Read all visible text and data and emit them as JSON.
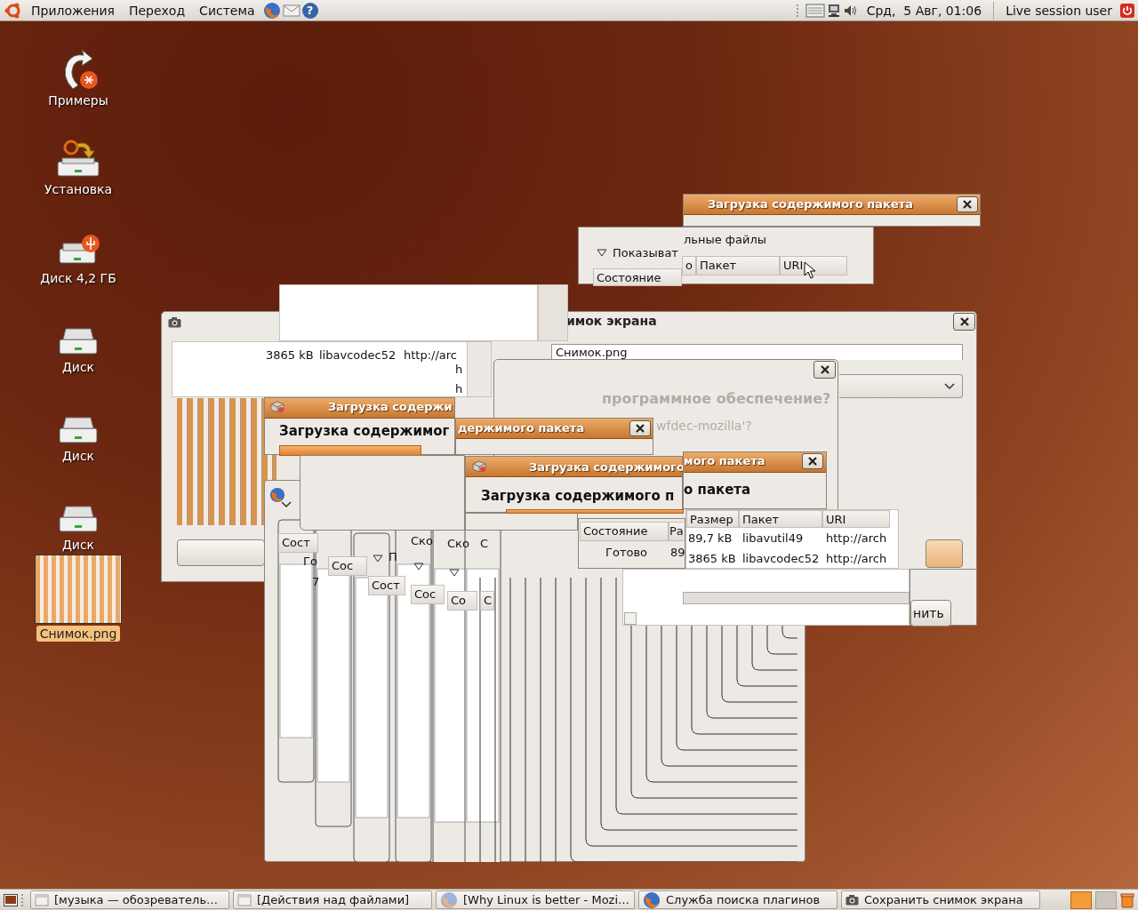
{
  "top_panel": {
    "menus": [
      "Приложения",
      "Переход",
      "Система"
    ],
    "help_glyph": "?",
    "clock": "Срд,  5 Авг, 01:06",
    "user": "Live session user"
  },
  "desktop_icons": [
    {
      "label": "Примеры",
      "kind": "examples",
      "selected": false
    },
    {
      "label": "Установка",
      "kind": "install",
      "selected": false
    },
    {
      "label": "Диск 4,2 ГБ",
      "kind": "usb",
      "selected": false
    },
    {
      "label": "Диск",
      "kind": "disk",
      "selected": false
    },
    {
      "label": "Диск",
      "kind": "disk",
      "selected": false
    },
    {
      "label": "Диск",
      "kind": "disk",
      "selected": false
    },
    {
      "label": "Снимок.png",
      "kind": "image",
      "selected": true
    }
  ],
  "windows": [
    {
      "kind": "panel",
      "items": [
        {
          "kind": "text",
          "text": "льные файлы"
        },
        {
          "kind": "expander"
        },
        {
          "kind": "text",
          "text": "Показыват"
        },
        {
          "kind": "header",
          "text": "Состояние"
        },
        {
          "kind": "header",
          "text": "о"
        },
        {
          "kind": "header",
          "text": "Пакет"
        },
        {
          "kind": "header",
          "text": "URI"
        },
        {
          "kind": "cursor"
        }
      ]
    },
    {
      "kind": "titled",
      "items": [
        {
          "kind": "title",
          "text": "Загрузка содержимого пакета"
        },
        {
          "kind": "close"
        }
      ]
    },
    {
      "kind": "dialog",
      "items": [
        {
          "kind": "camera"
        },
        {
          "kind": "title_dark",
          "text": "имок экрана"
        },
        {
          "kind": "close"
        },
        {
          "kind": "field",
          "text": "Снимок.png"
        },
        {
          "kind": "combo"
        },
        {
          "kind": "photo"
        },
        {
          "kind": "button"
        },
        {
          "kind": "default_button"
        }
      ]
    },
    {
      "kind": "white",
      "items": [
        {
          "kind": "cell",
          "text": "3865 kB"
        },
        {
          "kind": "cell",
          "text": "libavcodec52"
        },
        {
          "kind": "cell",
          "text": "http://arc"
        },
        {
          "kind": "cell",
          "text": "h"
        },
        {
          "kind": "cell",
          "text": "h"
        }
      ]
    },
    {
      "kind": "dialog",
      "items": [
        {
          "kind": "close"
        },
        {
          "kind": "muted_heading",
          "text": "программное обеспечение?"
        },
        {
          "kind": "muted",
          "text": "wfdec-mozilla'?"
        }
      ]
    },
    {
      "kind": "titled",
      "items": [
        {
          "kind": "package"
        },
        {
          "kind": "title",
          "text": "Загрузка содержи"
        },
        {
          "kind": "heading",
          "text": "Загрузка содержимог"
        },
        {
          "kind": "bar",
          "level": 1
        }
      ]
    },
    {
      "kind": "titled",
      "items": [
        {
          "kind": "title",
          "text": "держимого пакета"
        },
        {
          "kind": "close"
        }
      ]
    },
    {
      "kind": "cascade",
      "items": [
        {
          "kind": "firefox"
        },
        {
          "kind": "chevron"
        },
        {
          "kind": "header",
          "text": "Сост"
        },
        {
          "kind": "cell",
          "text": "Го"
        },
        {
          "kind": "cell",
          "text": "7"
        },
        {
          "kind": "header",
          "text": "Сос"
        },
        {
          "kind": "expander"
        },
        {
          "kind": "text",
          "text": "П"
        },
        {
          "kind": "header",
          "text": "Сост"
        },
        {
          "kind": "text",
          "text": "Ско"
        },
        {
          "kind": "expander"
        },
        {
          "kind": "header",
          "text": "Сос"
        },
        {
          "kind": "text",
          "text": "Ско"
        },
        {
          "kind": "expander"
        },
        {
          "kind": "header",
          "text": "Со"
        },
        {
          "kind": "text",
          "text": "С"
        },
        {
          "kind": "header",
          "text": "С"
        }
      ]
    },
    {
      "kind": "titled",
      "items": [
        {
          "kind": "package"
        },
        {
          "kind": "title",
          "text": "Загрузка содержимого"
        },
        {
          "kind": "heading",
          "text": "Загрузка содержимого п"
        },
        {
          "kind": "bar",
          "level": 1
        }
      ]
    },
    {
      "kind": "titled",
      "items": [
        {
          "kind": "title",
          "text": "мого пакета"
        },
        {
          "kind": "close"
        },
        {
          "kind": "heading",
          "text": "о пакета"
        }
      ]
    },
    {
      "kind": "panel",
      "items": [
        {
          "kind": "header",
          "text": "Состояние"
        },
        {
          "kind": "header",
          "text": "Ра"
        },
        {
          "kind": "cell",
          "text": "Готово"
        },
        {
          "kind": "cell",
          "text": "89"
        }
      ]
    },
    {
      "kind": "white",
      "items": [
        {
          "kind": "header",
          "text": "Размер"
        },
        {
          "kind": "header",
          "text": "Пакет"
        },
        {
          "kind": "header",
          "text": "URI"
        },
        {
          "kind": "cell",
          "text": "89,7 kB"
        },
        {
          "kind": "cell",
          "text": "libavutil49"
        },
        {
          "kind": "cell",
          "text": "http://arch"
        },
        {
          "kind": "cell",
          "text": "3865 kB"
        },
        {
          "kind": "cell",
          "text": "libavcodec52"
        },
        {
          "kind": "cell",
          "text": "http://arch"
        }
      ]
    },
    {
      "kind": "panel",
      "items": [
        {
          "kind": "button",
          "text": "нить"
        }
      ]
    }
  ],
  "taskbar": {
    "tasks": [
      {
        "label": "[музыка — обозреватель…",
        "kind": "files"
      },
      {
        "label": "[Действия над файлами]",
        "kind": "files"
      },
      {
        "label": "[Why Linux is better - Mozi…",
        "kind": "firefox_dim"
      },
      {
        "label": "Служба поиска плагинов",
        "kind": "firefox"
      },
      {
        "label": "Сохранить снимок экрана",
        "kind": "camera"
      }
    ],
    "workspaces": [
      {
        "selected": true
      },
      {
        "selected": false
      }
    ]
  }
}
